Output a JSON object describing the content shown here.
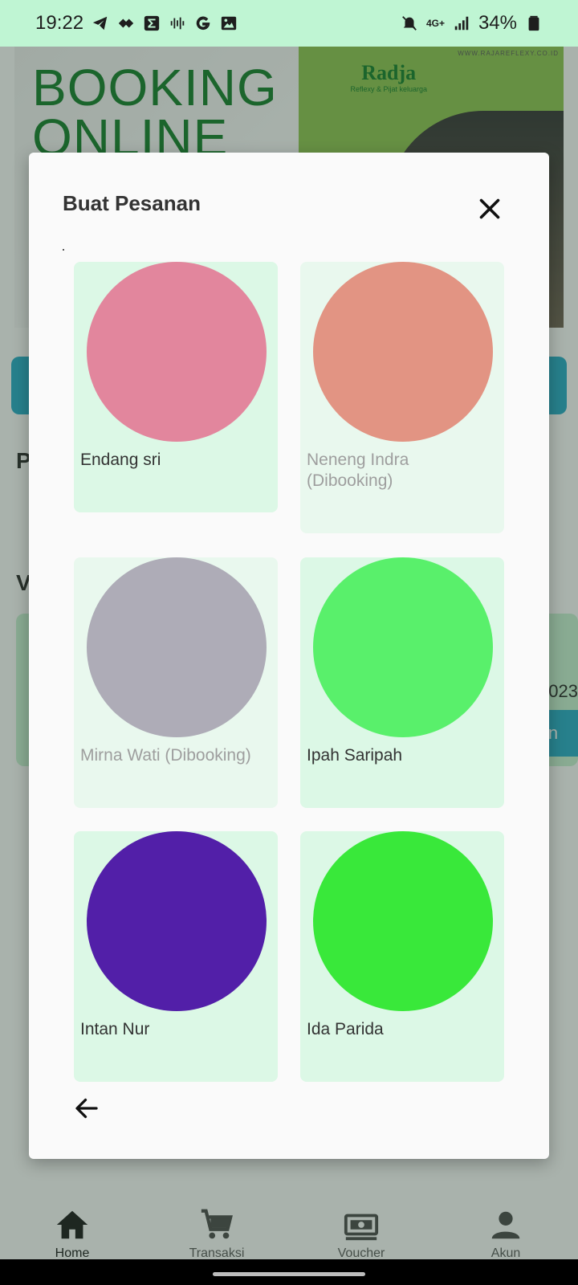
{
  "status_bar": {
    "time": "19:22",
    "network": "4G+",
    "battery": "34%",
    "icons": [
      "telegram-icon",
      "diamond-icon",
      "sigma-icon",
      "voice-icon",
      "google-icon",
      "image-icon",
      "mute-icon",
      "signal-icon",
      "battery-icon"
    ]
  },
  "background": {
    "banner": {
      "headline": "BOOKING\nONLINE",
      "brand_name": "Radja",
      "brand_tagline": "Reflexy & Pijat keluarga",
      "url": "WWW.RAJAREFLEXY.CO.ID"
    },
    "section_initial_1": "P",
    "section_initial_2": "V",
    "card_date_fragment": "023",
    "card_button_fragment": "n"
  },
  "dialog": {
    "title": "Buat Pesanan",
    "close_icon": "close-icon",
    "back_icon": "arrow-left-icon",
    "therapists": [
      {
        "name": "Endang sri",
        "color": "#e2869d",
        "booked": false
      },
      {
        "name": "Neneng Indra (Dibooking)",
        "color": "#e29483",
        "booked": true
      },
      {
        "name": "Mirna Wati (Dibooking)",
        "color": "#aeacb7",
        "booked": true
      },
      {
        "name": "Ipah Saripah",
        "color": "#59f06b",
        "booked": false
      },
      {
        "name": "Intan Nur",
        "color": "#521fa8",
        "booked": false
      },
      {
        "name": "Ida Parida",
        "color": "#39e83a",
        "booked": false
      }
    ]
  },
  "bottom_nav": {
    "items": [
      {
        "label": "Home",
        "icon": "home-icon",
        "active": true
      },
      {
        "label": "Transaksi",
        "icon": "cart-icon",
        "active": false
      },
      {
        "label": "Voucher",
        "icon": "voucher-icon",
        "active": false
      },
      {
        "label": "Akun",
        "icon": "account-icon",
        "active": false
      }
    ]
  }
}
